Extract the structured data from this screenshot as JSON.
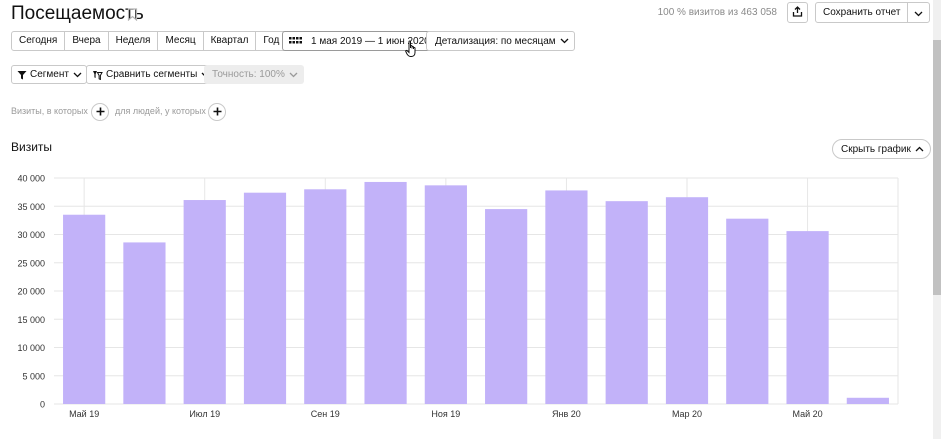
{
  "header": {
    "title": "Посещаемость",
    "sample_info": "100 % визитов из 463 058",
    "save_label": "Сохранить отчет"
  },
  "period_buttons": [
    "Сегодня",
    "Вчера",
    "Неделя",
    "Месяц",
    "Квартал",
    "Год"
  ],
  "date_range": "1 мая 2019 — 1 июн 2020",
  "detail_select": "Детализация: по месяцам",
  "segment": {
    "segment_label": "Сегмент",
    "compare_label": "Сравнить сегменты",
    "accuracy_label": "Точность: 100%"
  },
  "filters": {
    "visits_label": "Визиты, в которых",
    "people_label": "для людей, у которых"
  },
  "chart_header": {
    "title": "Визиты",
    "hide_label": "Скрыть график"
  },
  "colors": {
    "bar": "#c2b2f9",
    "grid": "#e6e6e6",
    "axis_text": "#333333"
  },
  "chart_data": {
    "type": "bar",
    "title": "Визиты",
    "categories": [
      "2019-05",
      "2019-06",
      "2019-07",
      "2019-08",
      "2019-09",
      "2019-10",
      "2019-11",
      "2019-12",
      "2020-01",
      "2020-02",
      "2020-03",
      "2020-04",
      "2020-05",
      "2020-06"
    ],
    "values": [
      33500,
      28600,
      36100,
      37400,
      38000,
      39300,
      38700,
      34500,
      37800,
      35900,
      36600,
      32800,
      30600,
      1100
    ],
    "x_tick_labels": [
      {
        "index": 0,
        "label": "Май 19"
      },
      {
        "index": 2,
        "label": "Июл 19"
      },
      {
        "index": 4,
        "label": "Сен 19"
      },
      {
        "index": 6,
        "label": "Ноя 19"
      },
      {
        "index": 8,
        "label": "Янв 20"
      },
      {
        "index": 10,
        "label": "Мар 20"
      },
      {
        "index": 12,
        "label": "Май 20"
      }
    ],
    "y_ticks": [
      "0",
      "5 000",
      "10 000",
      "15 000",
      "20 000",
      "25 000",
      "30 000",
      "35 000",
      "40 000"
    ],
    "ylim": [
      0,
      40000
    ],
    "grid": true,
    "xlabel": "",
    "ylabel": ""
  }
}
